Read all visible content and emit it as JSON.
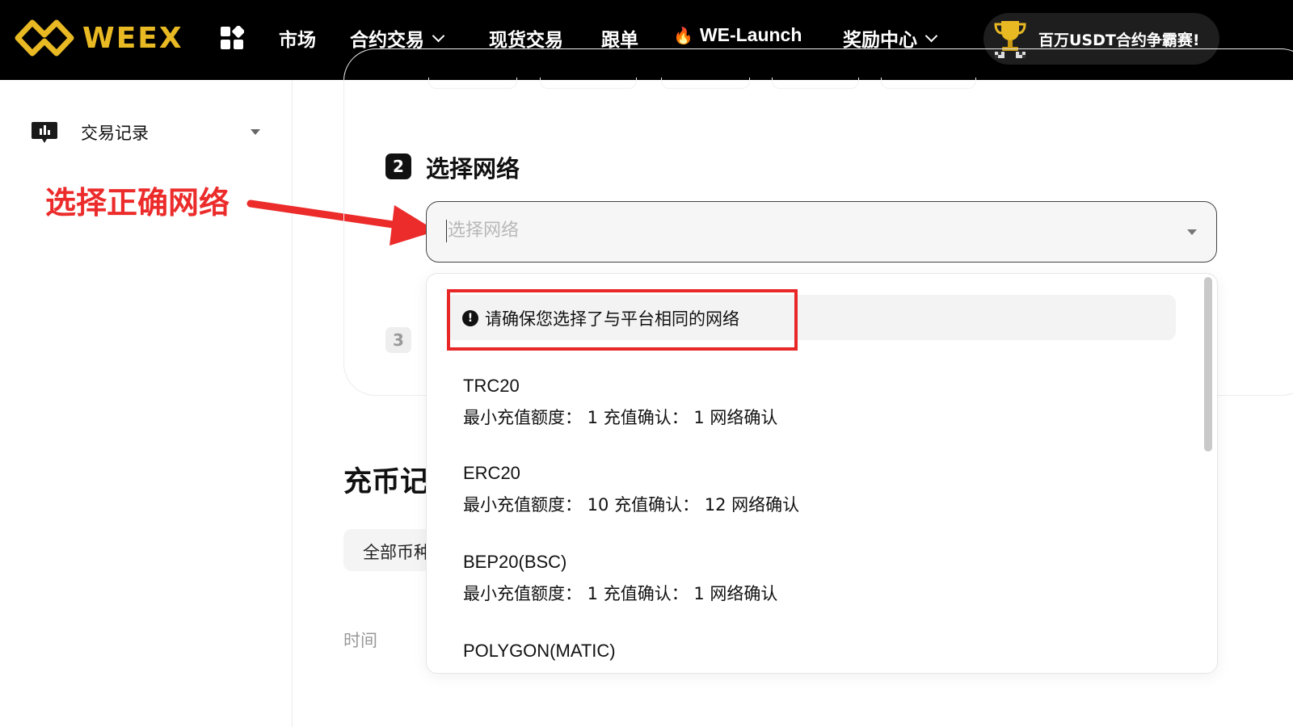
{
  "header": {
    "brand": "WEEX",
    "apps_icon": "grid-apps-icon",
    "nav": {
      "market": "市场",
      "futures": "合约交易",
      "spot": "现货交易",
      "copy": "跟单",
      "launch": "WE-Launch",
      "rewards": "奖励中心"
    },
    "promo": "百万USDT合约争霸赛!"
  },
  "sidebar": {
    "trade_records": "交易记录"
  },
  "annotation": {
    "text": "选择正确网络",
    "color": "#ec2b2b"
  },
  "steps": {
    "step2_number": "2",
    "step2_title": "选择网络",
    "step3_number": "3"
  },
  "network_select": {
    "placeholder": "选择网络"
  },
  "dropdown": {
    "warning": "请确保您选择了与平台相同的网络",
    "options": [
      {
        "name": "TRC20",
        "detail": "最小充值额度：  1 充值确认：  1 网络确认"
      },
      {
        "name": "ERC20",
        "detail": "最小充值额度：  10 充值确认：  12 网络确认"
      },
      {
        "name": "BEP20(BSC)",
        "detail": "最小充值额度：  1 充值确认：  1 网络确认"
      },
      {
        "name": "POLYGON(MATIC)",
        "detail": ""
      }
    ]
  },
  "records": {
    "title": "充币记录",
    "filter": "全部币种",
    "col_time": "时间"
  },
  "colors": {
    "brand_gold": "#e8b923",
    "topbar": "#000000",
    "highlight_red": "#e82727"
  }
}
